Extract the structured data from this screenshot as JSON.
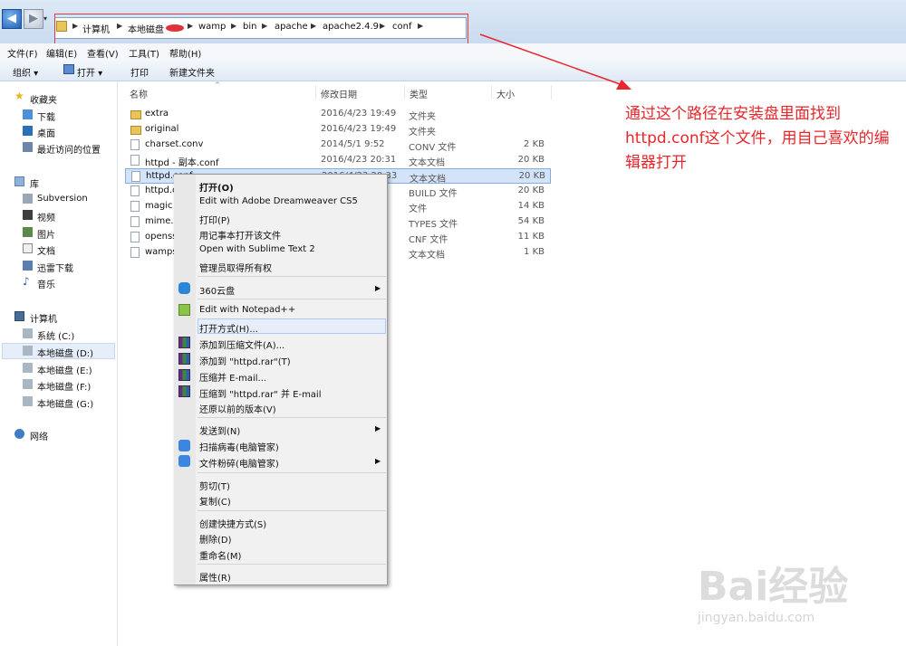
{
  "breadcrumb": [
    "计算机",
    "本地磁盘",
    "wamp",
    "bin",
    "apache",
    "apache2.4.9",
    "conf"
  ],
  "menubar": [
    "文件(F)",
    "编辑(E)",
    "查看(V)",
    "工具(T)",
    "帮助(H)"
  ],
  "toolbar": {
    "organize": "组织 ▾",
    "open": "打开 ▾",
    "print": "打印",
    "new_folder": "新建文件夹"
  },
  "sidebar": {
    "favorites": "收藏夹",
    "favorites_items": [
      "下载",
      "桌面",
      "最近访问的位置"
    ],
    "libraries": "库",
    "libraries_items": [
      "Subversion",
      "视频",
      "图片",
      "文档",
      "迅雷下载",
      "音乐"
    ],
    "computer": "计算机",
    "computer_items": [
      "系统 (C:)",
      "本地磁盘 (D:)",
      "本地磁盘 (E:)",
      "本地磁盘 (F:)",
      "本地磁盘 (G:)"
    ],
    "network": "网络"
  },
  "columns": {
    "name": "名称",
    "date": "修改日期",
    "type": "类型",
    "size": "大小"
  },
  "files": [
    {
      "name": "extra",
      "date": "2016/4/23 19:49",
      "type": "文件夹",
      "size": "",
      "kind": "folder"
    },
    {
      "name": "original",
      "date": "2016/4/23 19:49",
      "type": "文件夹",
      "size": "",
      "kind": "folder"
    },
    {
      "name": "charset.conv",
      "date": "2014/5/1 9:52",
      "type": "CONV 文件",
      "size": "2 KB",
      "kind": "doc"
    },
    {
      "name": "httpd - 副本.conf",
      "date": "2016/4/23 20:31",
      "type": "文本文档",
      "size": "20 KB",
      "kind": "doc"
    },
    {
      "name": "httpd.conf",
      "date": "2016/4/23 20:33",
      "type": "文本文档",
      "size": "20 KB",
      "kind": "doc"
    },
    {
      "name": "httpd.c",
      "date": "",
      "type": "BUILD 文件",
      "size": "20 KB",
      "kind": "doc"
    },
    {
      "name": "magic",
      "date": "",
      "type": "文件",
      "size": "14 KB",
      "kind": "doc"
    },
    {
      "name": "mime.t",
      "date": "",
      "type": "TYPES 文件",
      "size": "54 KB",
      "kind": "doc"
    },
    {
      "name": "openss",
      "date": "",
      "type": "CNF 文件",
      "size": "11 KB",
      "kind": "doc"
    },
    {
      "name": "wamps",
      "date": "",
      "type": "文本文档",
      "size": "1 KB",
      "kind": "doc"
    }
  ],
  "context_menu": {
    "open": "打开(O)",
    "edit_dw": "Edit with Adobe Dreamweaver CS5",
    "print": "打印(P)",
    "open_notepad": "用记事本打开该文件",
    "open_sublime": "Open with Sublime Text 2",
    "admin_own": "管理员取得所有权",
    "cloud360": "360云盘",
    "notepadpp": "Edit with Notepad++",
    "open_with": "打开方式(H)...",
    "add_archive": "添加到压缩文件(A)...",
    "add_rar": "添加到 \"httpd.rar\"(T)",
    "compress_email": "压缩并 E-mail...",
    "compress_rar_email": "压缩到 \"httpd.rar\" 并 E-mail",
    "restore": "还原以前的版本(V)",
    "send_to": "发送到(N)",
    "scan_virus": "扫描病毒(电脑管家)",
    "shred": "文件粉碎(电脑管家)",
    "cut": "剪切(T)",
    "copy": "复制(C)",
    "shortcut": "创建快捷方式(S)",
    "delete": "删除(D)",
    "rename": "重命名(M)",
    "properties": "属性(R)"
  },
  "annotation": "通过这个路径在安装盘里面找到httpd.conf这个文件，用自己喜欢的编辑器打开",
  "watermark": {
    "brand": "Bai经验",
    "url": "jingyan.baidu.com"
  },
  "colors": {
    "annotation": "#e8262b",
    "selection": "#d3e4fa"
  }
}
